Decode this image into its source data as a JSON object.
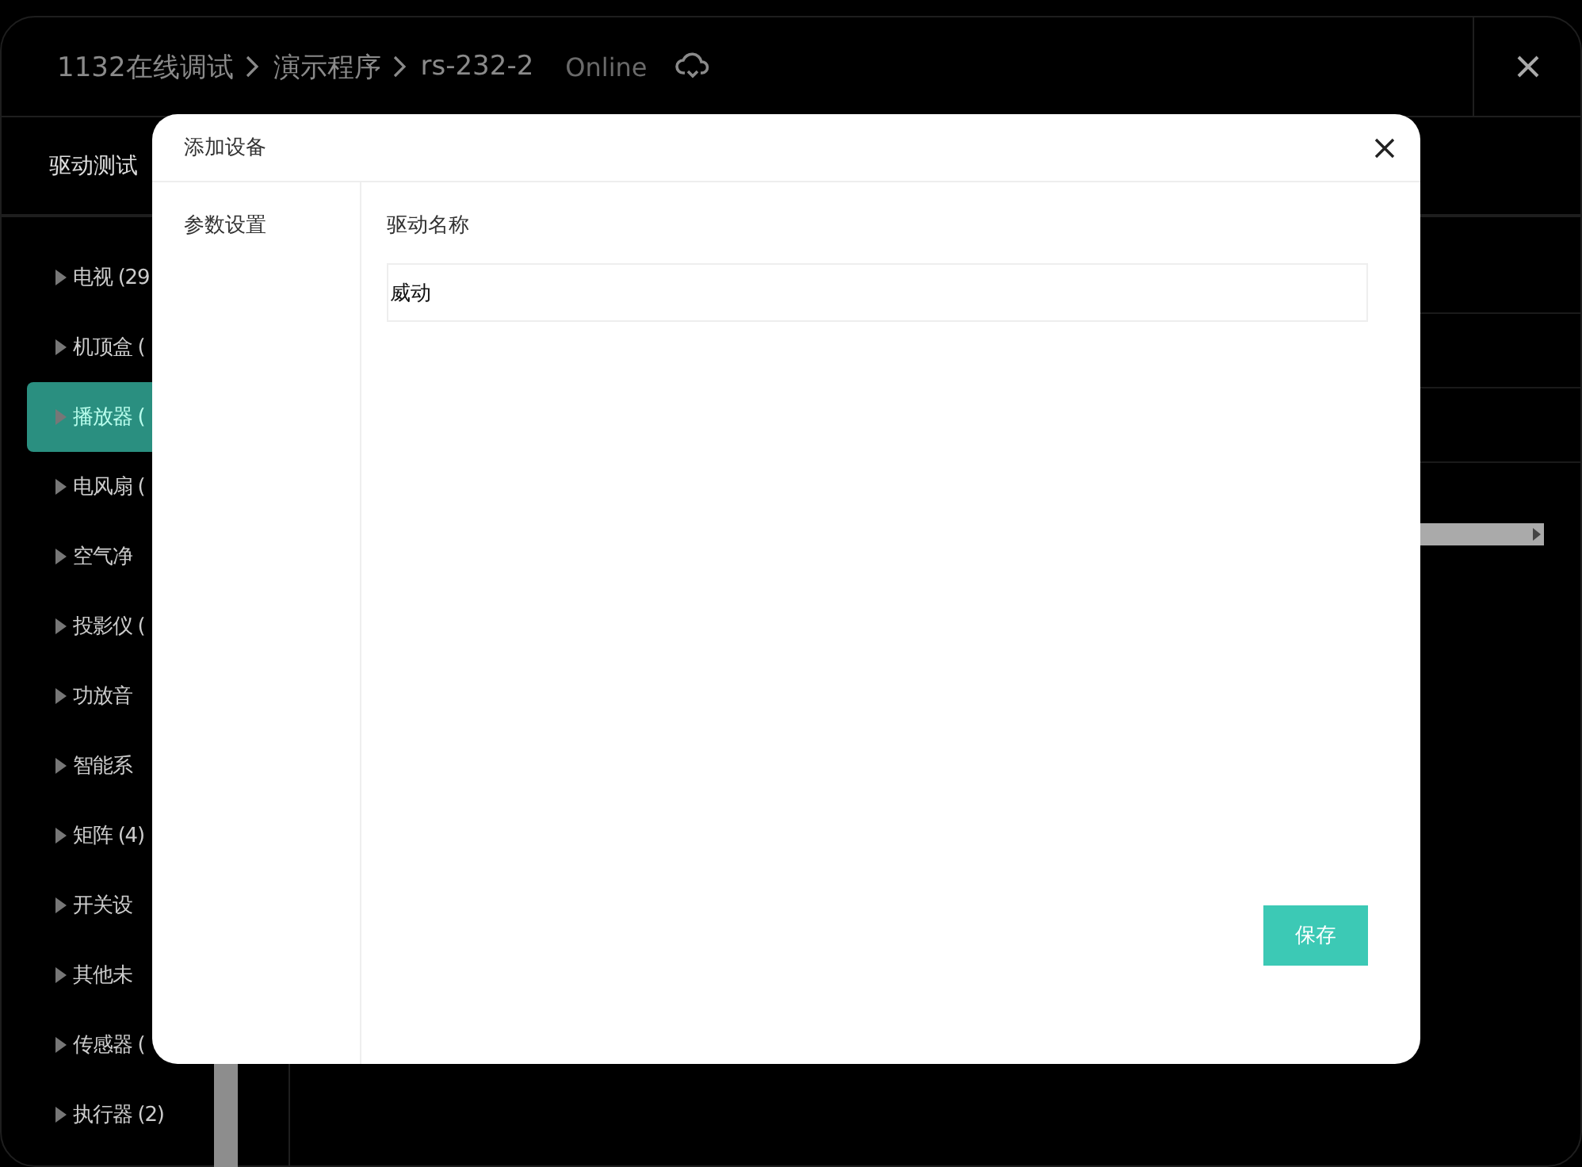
{
  "window": {
    "breadcrumb": [
      "1132在线调试",
      "演示程序",
      "rs-232-2"
    ],
    "status": "Online",
    "tab": "驱动测试"
  },
  "tree": [
    {
      "label": "电视 (29",
      "selected": false
    },
    {
      "label": "机顶盒 (",
      "selected": false
    },
    {
      "label": "播放器 (",
      "selected": true
    },
    {
      "label": "电风扇 (",
      "selected": false
    },
    {
      "label": "空气净",
      "selected": false
    },
    {
      "label": "投影仪 (",
      "selected": false
    },
    {
      "label": "功放音",
      "selected": false
    },
    {
      "label": "智能系",
      "selected": false
    },
    {
      "label": "矩阵 (4)",
      "selected": false
    },
    {
      "label": "开关设",
      "selected": false
    },
    {
      "label": "其他未",
      "selected": false
    },
    {
      "label": "传感器 (",
      "selected": false
    },
    {
      "label": "执行器 (2)",
      "selected": false
    }
  ],
  "dialog": {
    "title": "添加设备",
    "nav": [
      "参数设置"
    ],
    "field": {
      "label": "驱动名称",
      "value": "威动"
    },
    "save_button": "保存"
  }
}
